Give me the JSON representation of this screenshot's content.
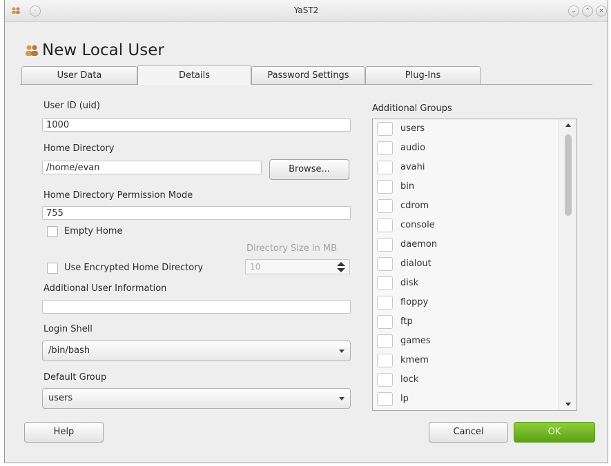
{
  "window": {
    "title": "YaST2",
    "controls": [
      "minimize-icon",
      "maximize-icon",
      "close-icon"
    ]
  },
  "page": {
    "heading": "New Local User",
    "heading_icon": "users-icon"
  },
  "tabs": [
    {
      "label": "User Data",
      "active": false
    },
    {
      "label": "Details",
      "active": true
    },
    {
      "label": "Password Settings",
      "active": false
    },
    {
      "label": "Plug-Ins",
      "active": false
    }
  ],
  "form": {
    "uid_label": "User ID (uid)",
    "uid_value": "1000",
    "home_label": "Home Directory",
    "home_value": "/home/evan",
    "browse_label": "Browse...",
    "perm_label": "Home Directory Permission Mode",
    "perm_value": "755",
    "empty_home_label": "Empty Home",
    "dir_size_label": "Directory Size in MB",
    "dir_size_value": "10",
    "encrypted_label": "Use Encrypted Home Directory",
    "add_info_label": "Additional User Information",
    "add_info_value": "",
    "login_shell_label": "Login Shell",
    "login_shell_value": "/bin/bash",
    "default_group_label": "Default Group",
    "default_group_value": "users"
  },
  "groups": {
    "label": "Additional Groups",
    "items": [
      "users",
      "audio",
      "avahi",
      "bin",
      "cdrom",
      "console",
      "daemon",
      "dialout",
      "disk",
      "floppy",
      "ftp",
      "games",
      "kmem",
      "lock",
      "lp"
    ]
  },
  "buttons": {
    "help": "Help",
    "cancel": "Cancel",
    "ok": "OK"
  },
  "colors": {
    "ok_green": "#6eb623",
    "window_bg": "#eeeeee"
  }
}
